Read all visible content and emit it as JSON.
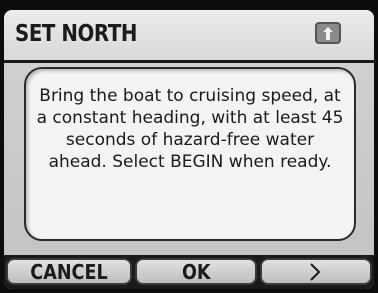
{
  "title": "SET NORTH",
  "header_icon": "up-arrow-icon",
  "message": "Bring the boat to cruising speed, at a constant heading, with at least 45 seconds of hazard-free water ahead. Select BEGIN when ready.",
  "softkeys": {
    "cancel_label": "CANCEL",
    "ok_label": "OK",
    "next_icon": "chevron-right-icon"
  }
}
